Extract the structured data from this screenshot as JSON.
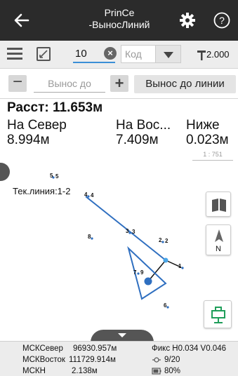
{
  "titlebar": {
    "title_line1": "PrinCe",
    "title_line2": "-ВыносЛиний"
  },
  "toolbar": {
    "point_number": "10",
    "code_placeholder": "Код",
    "pole_height": "2.000"
  },
  "stake": {
    "minus_label": "−",
    "input_placeholder": "Вынос до",
    "plus_label": "+",
    "stake_to_line_label": "Вынос до линии"
  },
  "results": {
    "distance": "Расст: 11.653м",
    "north_label": "На Север",
    "north_value": "8.994м",
    "east_label": "На Вос...",
    "east_value": "7.409м",
    "down_label": "Ниже",
    "down_value": "0.023м"
  },
  "map": {
    "scale": "1 : 751",
    "line_label": "Тек.линия:1-2",
    "points": [
      {
        "label": "5",
        "sub": "5"
      },
      {
        "label": "4",
        "sub": "4"
      },
      {
        "label": "8",
        "sub": ""
      },
      {
        "label": "3",
        "sub": "3"
      },
      {
        "label": "2",
        "sub": "2"
      },
      {
        "label": "7",
        "sub": "9"
      },
      {
        "label": "1",
        "sub": ""
      },
      {
        "label": "6",
        "sub": ""
      }
    ],
    "north_letter": "N"
  },
  "footer": {
    "msk_north_label": "МСКСевер",
    "msk_north_value": "96930.957м",
    "msk_east_label": "МСКВосток",
    "msk_east_value": "111729.914м",
    "msk_h_label": "МСКН",
    "msk_h_value": "2.138м",
    "fix_status": "Фикс H0.034 V0.046",
    "satellites": "9/20",
    "battery": "80%"
  },
  "colors": {
    "titlebar": "#2b2b2b",
    "accent": "#3b8fd6",
    "line": "#2f6fc0",
    "rover_green": "#1f9e5a"
  }
}
